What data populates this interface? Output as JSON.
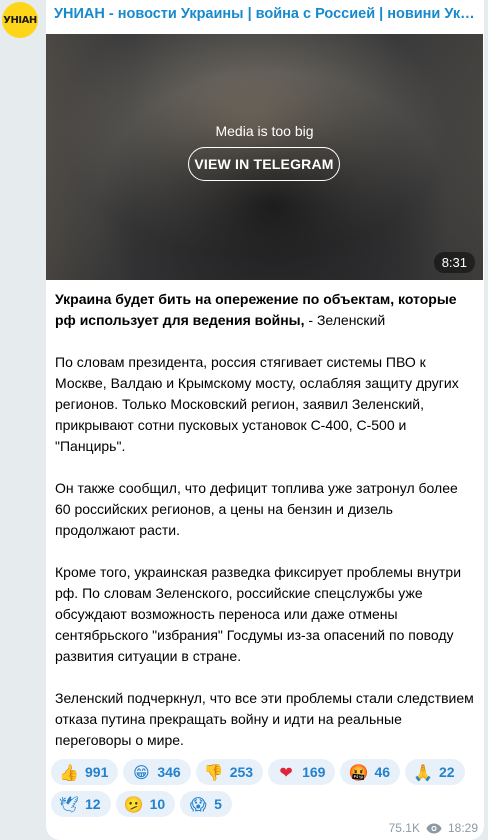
{
  "channel": {
    "title": "УНИАН - новости Украины | война с Россией | новини України",
    "avatar_text": "УНІАН",
    "avatar_color": "#ffd51a"
  },
  "media": {
    "message": "Media is too big",
    "button_label": "VIEW IN TELEGRAM",
    "duration": "8:31"
  },
  "post": {
    "headline_bold": "Украина будет бить на опережение по объектам, которые рф использует для ведения войны,",
    "headline_rest": " - Зеленский",
    "paragraphs": [
      "По словам президента, россия стягивает системы ПВО к Москве, Валдаю и Крымскому мосту, ослабляя защиту других регионов. Только Московский регион, заявил Зеленский, прикрывают сотни пусковых установок С-400, С-500 и \"Панцирь\".",
      "Он также сообщил, что дефицит топлива уже затронул более 60 российских регионов, а цены на бензин и дизель продолжают расти.",
      "Кроме того, украинская разведка фиксирует проблемы внутри рф. По словам Зеленского, российские спецслужбы уже обсуждают возможность переноса или даже отмены сентябрьского \"избрания\" Госдумы из-за опасений по поводу развития ситуации в стране.",
      "Зеленский подчеркнул, что все эти проблемы стали следствием отказа путина прекращать войну и идти на реальные переговоры о мире."
    ]
  },
  "reactions": [
    {
      "icon": "thumbs-up-icon",
      "glyph": "👍",
      "count": "991"
    },
    {
      "icon": "grinning-face-icon",
      "glyph": "😁",
      "count": "346"
    },
    {
      "icon": "thumbs-down-icon",
      "glyph": "👎",
      "count": "253"
    },
    {
      "icon": "red-heart-icon",
      "glyph": "❤",
      "count": "169"
    },
    {
      "icon": "angry-face-icon",
      "glyph": "🤬",
      "count": "46"
    },
    {
      "icon": "folded-hands-icon",
      "glyph": "🙏",
      "count": "22"
    },
    {
      "icon": "dove-icon",
      "glyph": "🕊",
      "count": "12"
    },
    {
      "icon": "confused-face-icon",
      "glyph": "🫤",
      "count": "10"
    },
    {
      "icon": "screaming-face-icon",
      "glyph": "😱",
      "count": "5"
    }
  ],
  "meta": {
    "views": "75.1K",
    "time": "18:29"
  },
  "colors": {
    "accent": "#168acd",
    "reaction_bg": "#e8f1fa",
    "reaction_text": "#2481cc"
  }
}
